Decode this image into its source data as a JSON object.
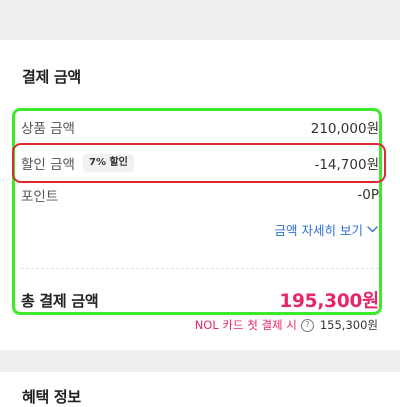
{
  "section": {
    "title": "결제 금액"
  },
  "rows": [
    {
      "label": "상품 금액",
      "value": "210,000원"
    },
    {
      "label": "할인 금액",
      "badge": "7% 할인",
      "value": "-14,700원"
    },
    {
      "label": "포인트",
      "value": "-0P"
    }
  ],
  "detail_link": {
    "label": "금액 자세히 보기",
    "icon": "chevron-down-icon"
  },
  "total": {
    "label": "총 결제 금액",
    "value": "195,300원"
  },
  "card_offer": {
    "label": "NOL 카드 첫 결제 시",
    "icon": "question-circle-icon",
    "value": "155,300원"
  },
  "next_section": {
    "title": "혜택 정보"
  },
  "colors": {
    "accent_pink": "#e6266b",
    "link_blue": "#2f6fd6",
    "highlight_green": "#3dea2b",
    "highlight_red": "#e0282e",
    "band_gray": "#efeff1"
  }
}
